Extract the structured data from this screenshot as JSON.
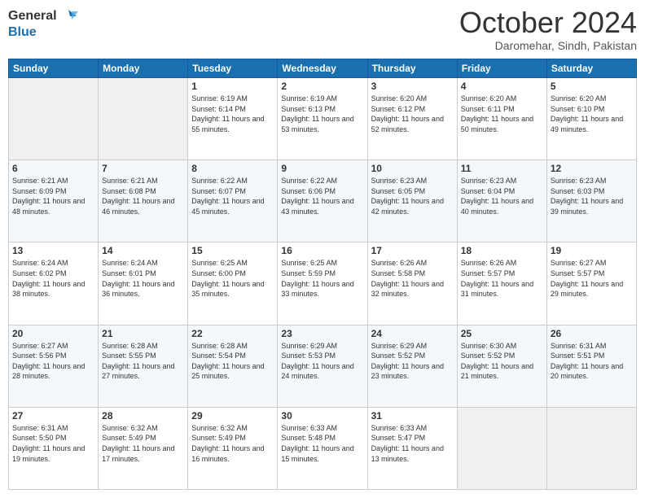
{
  "header": {
    "logo_general": "General",
    "logo_blue": "Blue",
    "month_title": "October 2024",
    "location": "Daromehar, Sindh, Pakistan"
  },
  "weekdays": [
    "Sunday",
    "Monday",
    "Tuesday",
    "Wednesday",
    "Thursday",
    "Friday",
    "Saturday"
  ],
  "weeks": [
    [
      {
        "day": "",
        "info": ""
      },
      {
        "day": "",
        "info": ""
      },
      {
        "day": "1",
        "sunrise": "Sunrise: 6:19 AM",
        "sunset": "Sunset: 6:14 PM",
        "daylight": "Daylight: 11 hours and 55 minutes."
      },
      {
        "day": "2",
        "sunrise": "Sunrise: 6:19 AM",
        "sunset": "Sunset: 6:13 PM",
        "daylight": "Daylight: 11 hours and 53 minutes."
      },
      {
        "day": "3",
        "sunrise": "Sunrise: 6:20 AM",
        "sunset": "Sunset: 6:12 PM",
        "daylight": "Daylight: 11 hours and 52 minutes."
      },
      {
        "day": "4",
        "sunrise": "Sunrise: 6:20 AM",
        "sunset": "Sunset: 6:11 PM",
        "daylight": "Daylight: 11 hours and 50 minutes."
      },
      {
        "day": "5",
        "sunrise": "Sunrise: 6:20 AM",
        "sunset": "Sunset: 6:10 PM",
        "daylight": "Daylight: 11 hours and 49 minutes."
      }
    ],
    [
      {
        "day": "6",
        "sunrise": "Sunrise: 6:21 AM",
        "sunset": "Sunset: 6:09 PM",
        "daylight": "Daylight: 11 hours and 48 minutes."
      },
      {
        "day": "7",
        "sunrise": "Sunrise: 6:21 AM",
        "sunset": "Sunset: 6:08 PM",
        "daylight": "Daylight: 11 hours and 46 minutes."
      },
      {
        "day": "8",
        "sunrise": "Sunrise: 6:22 AM",
        "sunset": "Sunset: 6:07 PM",
        "daylight": "Daylight: 11 hours and 45 minutes."
      },
      {
        "day": "9",
        "sunrise": "Sunrise: 6:22 AM",
        "sunset": "Sunset: 6:06 PM",
        "daylight": "Daylight: 11 hours and 43 minutes."
      },
      {
        "day": "10",
        "sunrise": "Sunrise: 6:23 AM",
        "sunset": "Sunset: 6:05 PM",
        "daylight": "Daylight: 11 hours and 42 minutes."
      },
      {
        "day": "11",
        "sunrise": "Sunrise: 6:23 AM",
        "sunset": "Sunset: 6:04 PM",
        "daylight": "Daylight: 11 hours and 40 minutes."
      },
      {
        "day": "12",
        "sunrise": "Sunrise: 6:23 AM",
        "sunset": "Sunset: 6:03 PM",
        "daylight": "Daylight: 11 hours and 39 minutes."
      }
    ],
    [
      {
        "day": "13",
        "sunrise": "Sunrise: 6:24 AM",
        "sunset": "Sunset: 6:02 PM",
        "daylight": "Daylight: 11 hours and 38 minutes."
      },
      {
        "day": "14",
        "sunrise": "Sunrise: 6:24 AM",
        "sunset": "Sunset: 6:01 PM",
        "daylight": "Daylight: 11 hours and 36 minutes."
      },
      {
        "day": "15",
        "sunrise": "Sunrise: 6:25 AM",
        "sunset": "Sunset: 6:00 PM",
        "daylight": "Daylight: 11 hours and 35 minutes."
      },
      {
        "day": "16",
        "sunrise": "Sunrise: 6:25 AM",
        "sunset": "Sunset: 5:59 PM",
        "daylight": "Daylight: 11 hours and 33 minutes."
      },
      {
        "day": "17",
        "sunrise": "Sunrise: 6:26 AM",
        "sunset": "Sunset: 5:58 PM",
        "daylight": "Daylight: 11 hours and 32 minutes."
      },
      {
        "day": "18",
        "sunrise": "Sunrise: 6:26 AM",
        "sunset": "Sunset: 5:57 PM",
        "daylight": "Daylight: 11 hours and 31 minutes."
      },
      {
        "day": "19",
        "sunrise": "Sunrise: 6:27 AM",
        "sunset": "Sunset: 5:57 PM",
        "daylight": "Daylight: 11 hours and 29 minutes."
      }
    ],
    [
      {
        "day": "20",
        "sunrise": "Sunrise: 6:27 AM",
        "sunset": "Sunset: 5:56 PM",
        "daylight": "Daylight: 11 hours and 28 minutes."
      },
      {
        "day": "21",
        "sunrise": "Sunrise: 6:28 AM",
        "sunset": "Sunset: 5:55 PM",
        "daylight": "Daylight: 11 hours and 27 minutes."
      },
      {
        "day": "22",
        "sunrise": "Sunrise: 6:28 AM",
        "sunset": "Sunset: 5:54 PM",
        "daylight": "Daylight: 11 hours and 25 minutes."
      },
      {
        "day": "23",
        "sunrise": "Sunrise: 6:29 AM",
        "sunset": "Sunset: 5:53 PM",
        "daylight": "Daylight: 11 hours and 24 minutes."
      },
      {
        "day": "24",
        "sunrise": "Sunrise: 6:29 AM",
        "sunset": "Sunset: 5:52 PM",
        "daylight": "Daylight: 11 hours and 23 minutes."
      },
      {
        "day": "25",
        "sunrise": "Sunrise: 6:30 AM",
        "sunset": "Sunset: 5:52 PM",
        "daylight": "Daylight: 11 hours and 21 minutes."
      },
      {
        "day": "26",
        "sunrise": "Sunrise: 6:31 AM",
        "sunset": "Sunset: 5:51 PM",
        "daylight": "Daylight: 11 hours and 20 minutes."
      }
    ],
    [
      {
        "day": "27",
        "sunrise": "Sunrise: 6:31 AM",
        "sunset": "Sunset: 5:50 PM",
        "daylight": "Daylight: 11 hours and 19 minutes."
      },
      {
        "day": "28",
        "sunrise": "Sunrise: 6:32 AM",
        "sunset": "Sunset: 5:49 PM",
        "daylight": "Daylight: 11 hours and 17 minutes."
      },
      {
        "day": "29",
        "sunrise": "Sunrise: 6:32 AM",
        "sunset": "Sunset: 5:49 PM",
        "daylight": "Daylight: 11 hours and 16 minutes."
      },
      {
        "day": "30",
        "sunrise": "Sunrise: 6:33 AM",
        "sunset": "Sunset: 5:48 PM",
        "daylight": "Daylight: 11 hours and 15 minutes."
      },
      {
        "day": "31",
        "sunrise": "Sunrise: 6:33 AM",
        "sunset": "Sunset: 5:47 PM",
        "daylight": "Daylight: 11 hours and 13 minutes."
      },
      {
        "day": "",
        "info": ""
      },
      {
        "day": "",
        "info": ""
      }
    ]
  ]
}
